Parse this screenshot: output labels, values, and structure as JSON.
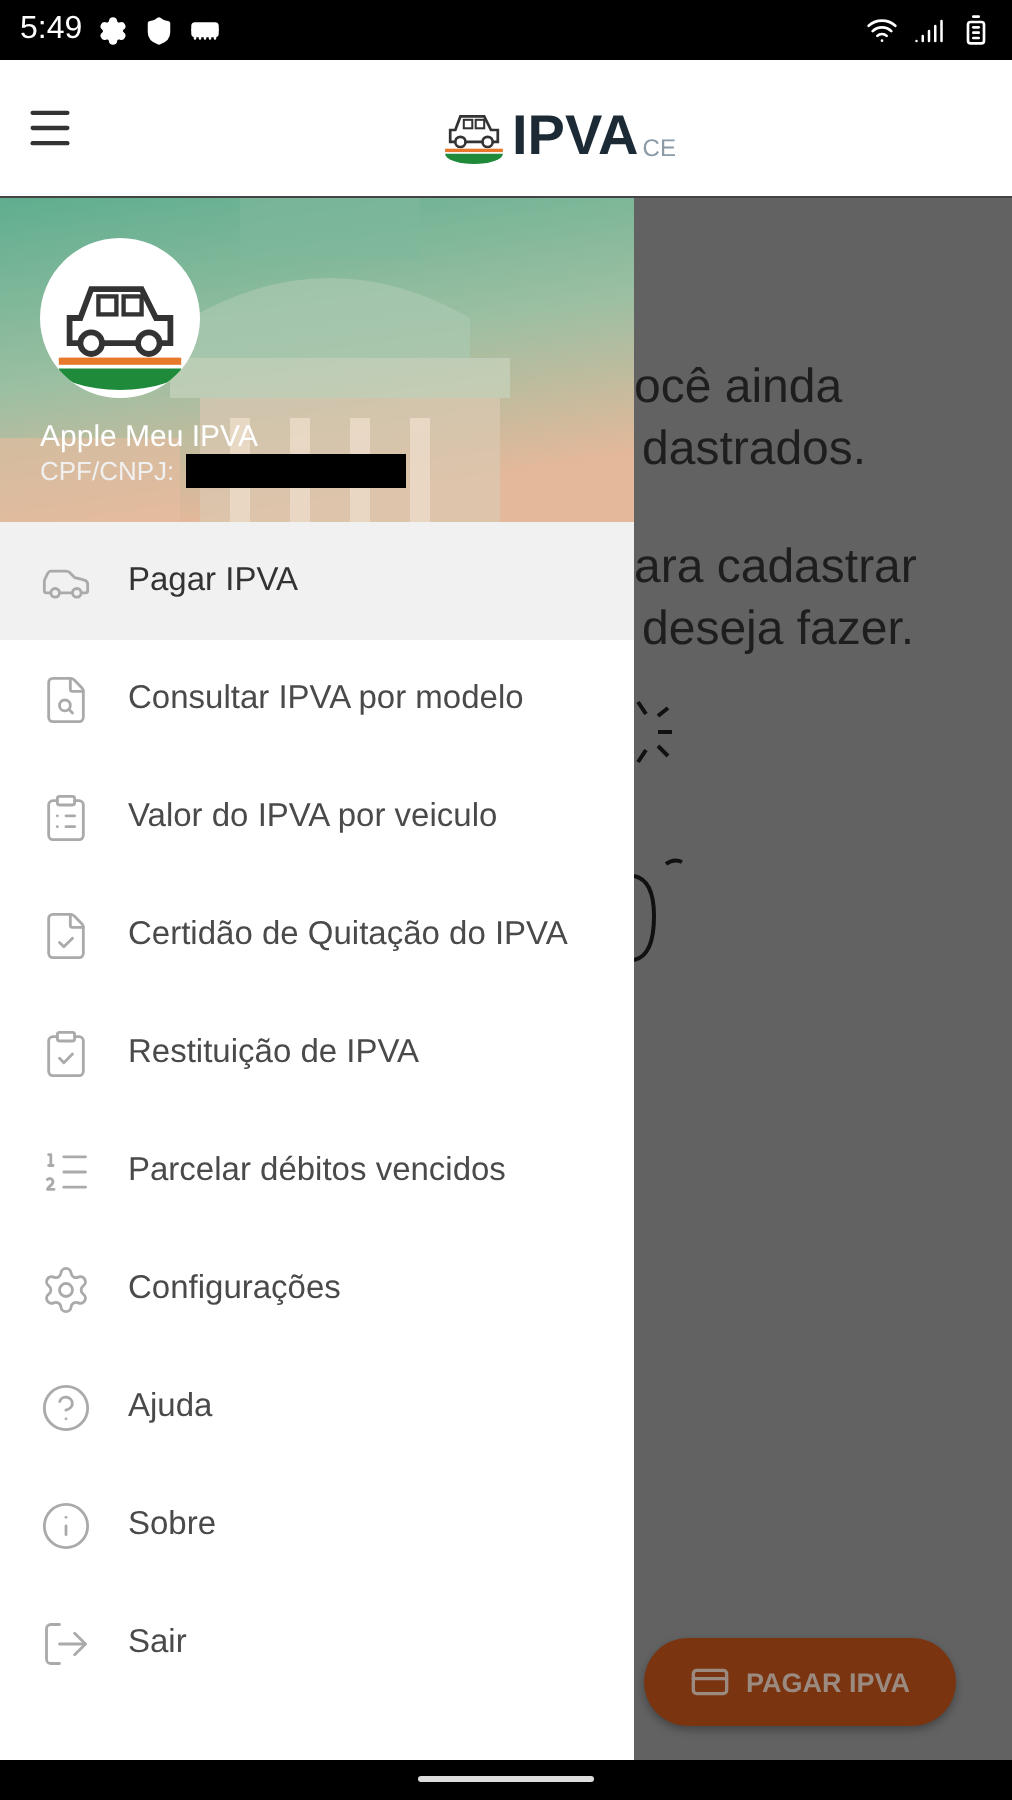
{
  "status_bar": {
    "time": "5:49"
  },
  "app_bar": {
    "logo_text": "IPVA",
    "logo_suffix": "CE"
  },
  "drawer": {
    "user_name": "Apple Meu IPVA",
    "document_label": "CPF/CNPJ:",
    "items": [
      {
        "label": "Pagar IPVA",
        "kind": "car",
        "selected": true
      },
      {
        "label": "Consultar IPVA por modelo",
        "kind": "search",
        "selected": false
      },
      {
        "label": "Valor do IPVA por veiculo",
        "kind": "badge",
        "selected": false
      },
      {
        "label": "Certidão de Quitação do IPVA",
        "kind": "certificate",
        "selected": false
      },
      {
        "label": "Restituição de IPVA",
        "kind": "refund",
        "selected": false
      },
      {
        "label": "Parcelar débitos vencidos",
        "kind": "list",
        "selected": false
      },
      {
        "label": "Configurações",
        "kind": "settings",
        "selected": false
      },
      {
        "label": "Ajuda",
        "kind": "help",
        "selected": false
      },
      {
        "label": "Sobre",
        "kind": "info",
        "selected": false
      },
      {
        "label": "Sair",
        "kind": "logout",
        "selected": false
      }
    ]
  },
  "background": {
    "lines": [
      "ocê ainda",
      "dastrados.",
      "ara cadastrar",
      "deseja fazer."
    ],
    "fab_label": "PAGAR IPVA"
  }
}
